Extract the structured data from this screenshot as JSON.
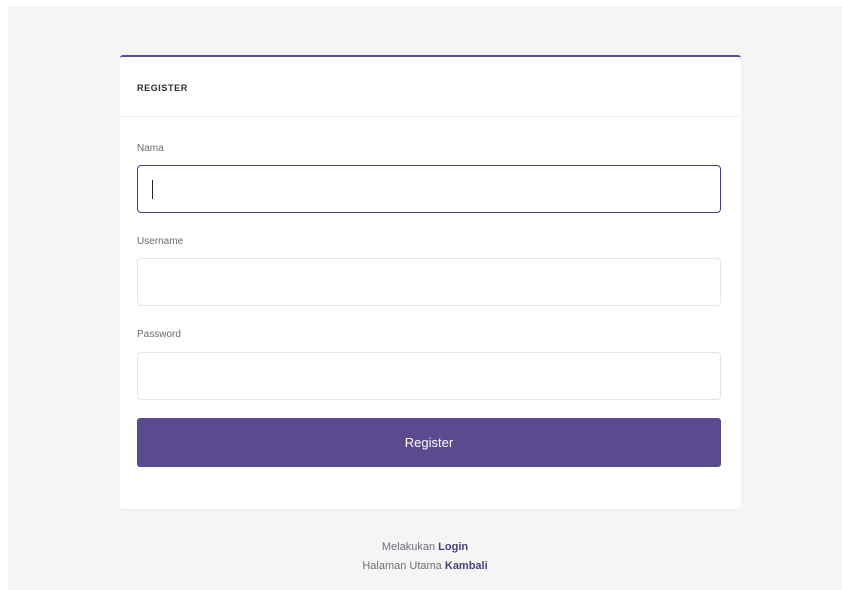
{
  "card": {
    "title": "REGISTER"
  },
  "form": {
    "nama": {
      "label": "Nama",
      "value": "",
      "placeholder": ""
    },
    "username": {
      "label": "Username",
      "value": "",
      "placeholder": ""
    },
    "password": {
      "label": "Password",
      "value": "",
      "placeholder": ""
    },
    "submit_label": "Register"
  },
  "footer": {
    "login_prefix": "Melakukan",
    "login_link": "Login",
    "home_prefix": "Halaman Utama",
    "home_link": "Kambali"
  },
  "colors": {
    "accent": "#594b8d",
    "focus_border": "#4a3f7a",
    "page_background": "#f5f5f6"
  }
}
